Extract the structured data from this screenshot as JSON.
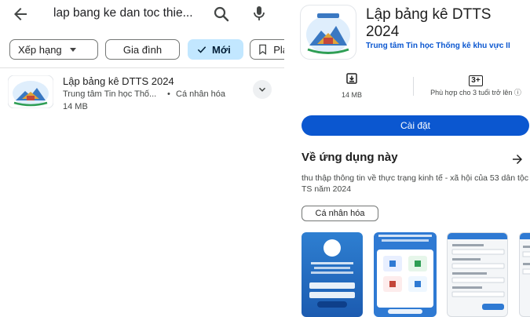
{
  "search": {
    "query": "lap bang ke dan toc thie...",
    "back_icon": "arrow-back-icon",
    "search_icon": "search-icon",
    "mic_icon": "mic-icon"
  },
  "filters": {
    "chips": [
      {
        "label": "Xếp hạng",
        "has_dropdown": true,
        "selected": false
      },
      {
        "label": "Gia đình",
        "selected": false
      },
      {
        "label": "Mới",
        "selected": true,
        "icon": "check-icon"
      },
      {
        "label": "Pla",
        "icon": "bookmark-icon",
        "selected": false
      }
    ]
  },
  "result": {
    "title": "Lập bảng kê DTTS 2024",
    "developer": "Trung tâm Tin học Thố...",
    "separator": "•",
    "category": "Cá nhân hóa",
    "size": "14 MB"
  },
  "detail": {
    "title": "Lập bảng kê DTTS 2024",
    "developer": "Trung tâm Tin học Thống kê khu vực II",
    "stats": {
      "size_value": "14 MB",
      "size_icon": "download-icon",
      "rating_badge": "3+",
      "rating_text": "Phù hợp cho 3 tuổi trở lên ⓘ"
    },
    "install_label": "Cài đặt",
    "about_title": "Về ứng dụng này",
    "description": "thu thập thông tin về thực trạng kinh tế - xã hội của 53 dân tộc TS năm 2024",
    "tag": "Cá nhân hóa"
  },
  "colors": {
    "accent": "#0b57d0",
    "chip_selected": "#c2e7ff",
    "text": "#1f1f1f",
    "muted": "#444746"
  }
}
